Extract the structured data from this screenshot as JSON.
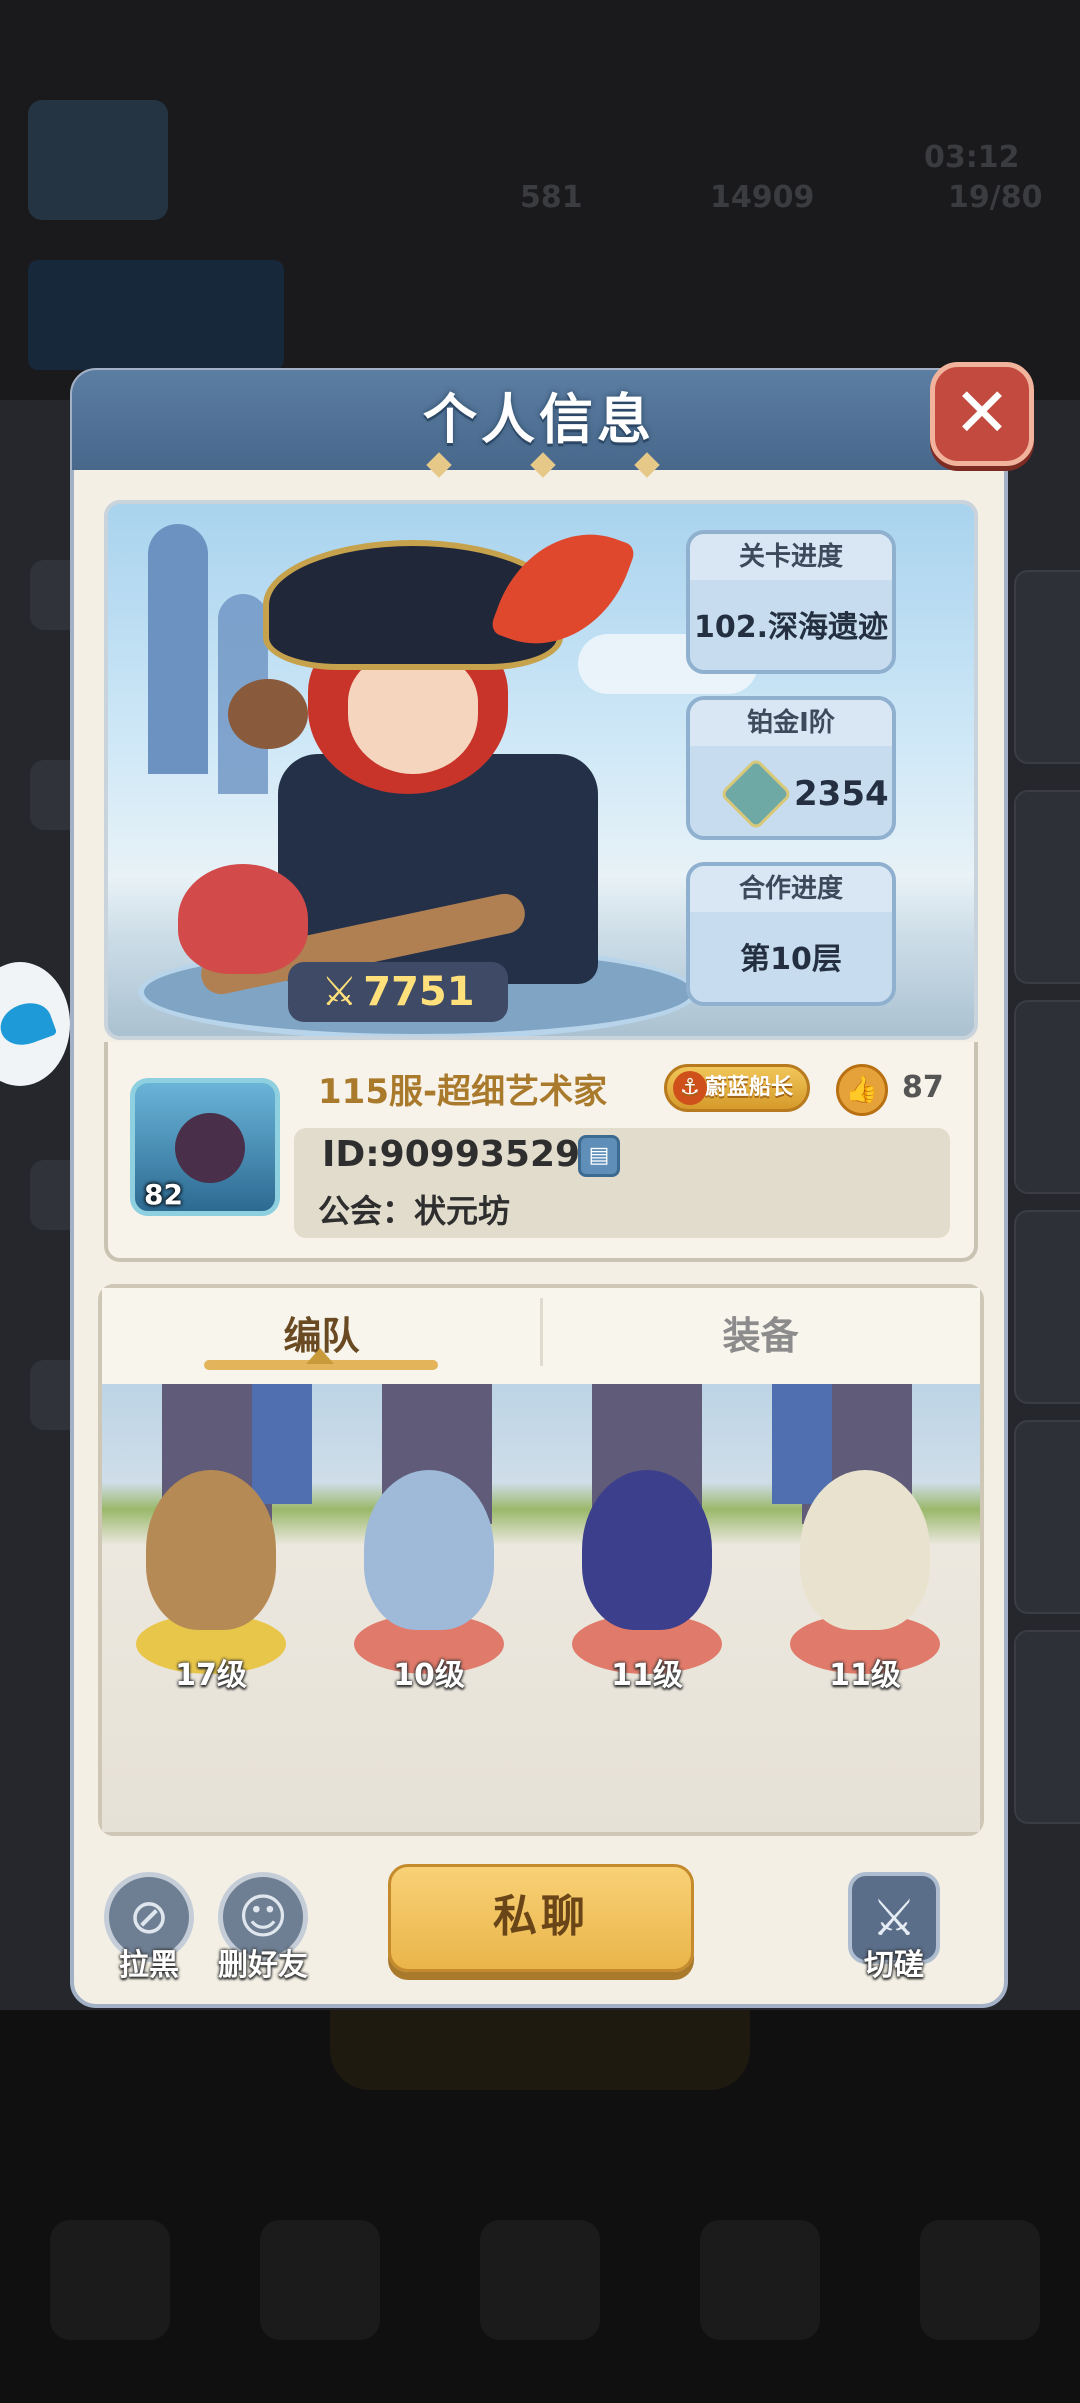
{
  "background": {
    "stats": [
      "581",
      "14909",
      "19/80"
    ],
    "time": "03:12"
  },
  "dialog": {
    "title": "个人信息",
    "close_icon": "close-x-icon"
  },
  "hero": {
    "power": "7751",
    "stats": [
      {
        "label": "关卡进度",
        "value": "102.深海遗迹"
      },
      {
        "label": "铂金I阶",
        "value": "2354"
      },
      {
        "label": "合作进度",
        "value": "第10层"
      }
    ]
  },
  "profile": {
    "avatar_level": "82",
    "name": "115服-超细艺术家",
    "title_badge": "蔚蓝船长",
    "likes": "87",
    "id": "ID:90993529",
    "guild": "公会：状元坊"
  },
  "tabs": [
    "编队",
    "装备"
  ],
  "team": {
    "units": [
      {
        "level": "17级",
        "ring": "#e8c64a",
        "color": "#b68a55"
      },
      {
        "level": "10级",
        "ring": "#e07a6a",
        "color": "#9fb9d8"
      },
      {
        "level": "11级",
        "ring": "#e07a6a",
        "color": "#3c3f8c"
      },
      {
        "level": "11级",
        "ring": "#e07a6a",
        "color": "#e8e2cf"
      }
    ]
  },
  "actions": {
    "block": "拉黑",
    "remove_friend": "删好友",
    "chat": "私聊",
    "duel": "切磋"
  }
}
